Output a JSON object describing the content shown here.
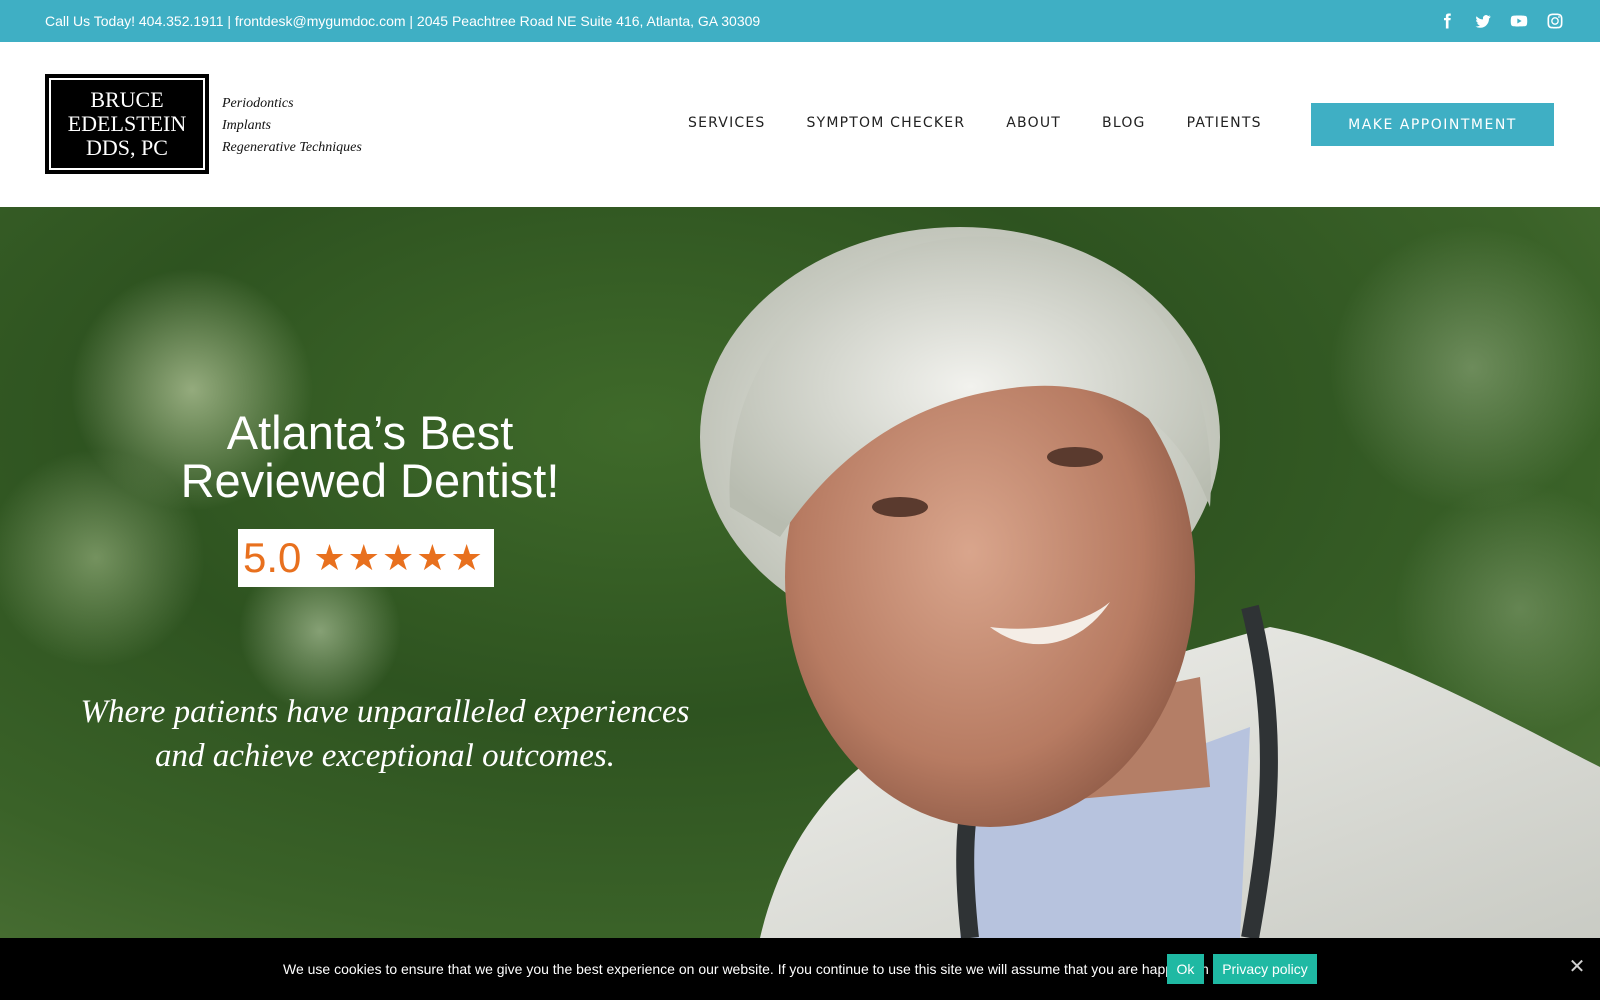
{
  "topbar": {
    "contact": "Call Us Today! 404.352.1911  |  frontdesk@mygumdoc.com | 2045 Peachtree Road NE Suite 416, Atlanta, GA 30309",
    "social": [
      "facebook-icon",
      "twitter-icon",
      "youtube-icon",
      "instagram-icon"
    ],
    "background": "#3fafc4"
  },
  "logo": {
    "line1": "BRUCE",
    "line2": "EDELSTEIN",
    "line3": "DDS, PC",
    "tagline": [
      "Periodontics",
      "Implants",
      "Regenerative Techniques"
    ]
  },
  "nav": {
    "items": [
      "SERVICES",
      "SYMPTOM CHECKER",
      "ABOUT",
      "BLOG",
      "PATIENTS"
    ],
    "cta": "MAKE APPOINTMENT"
  },
  "hero": {
    "title_line1": "Atlanta’s Best",
    "title_line2": "Reviewed Dentist!",
    "rating_score": "5.0",
    "rating_stars": "★★★★★",
    "quote_line1": "Where patients have unparalleled experiences",
    "quote_line2": "and achieve exceptional outcomes."
  },
  "cookie": {
    "message": "We use cookies to ensure that we give you the best experience on our website. If you continue to use this site we will assume that you are happy with it.",
    "ok_label": "Ok",
    "privacy_label": "Privacy policy",
    "close_symbol": "✕"
  },
  "colors": {
    "accent": "#3fafc4",
    "rating_orange": "#e8701e",
    "cookie_button": "#1fb9a3"
  }
}
